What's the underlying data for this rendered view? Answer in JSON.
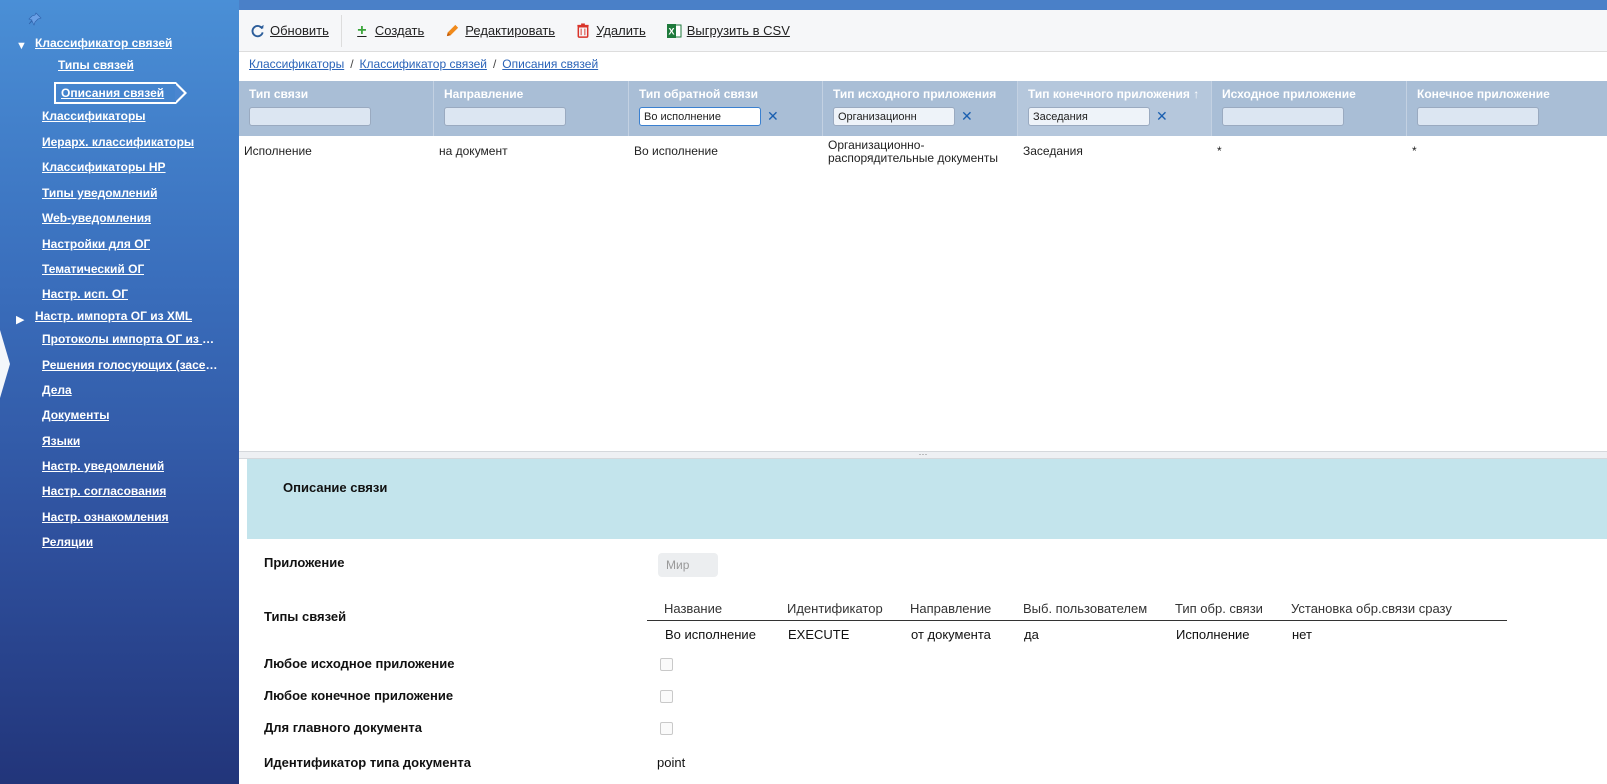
{
  "sidebar": {
    "items": [
      {
        "label": "Классификатор связей",
        "expanded": true,
        "level": 0
      },
      {
        "label": "Типы связей",
        "level": 2
      },
      {
        "label": "Описания связей",
        "level": 2,
        "active": true
      },
      {
        "label": "Классификаторы",
        "level": 1
      },
      {
        "label": "Иерарх. классификаторы",
        "level": 1
      },
      {
        "label": "Классификаторы НР",
        "level": 1
      },
      {
        "label": "Типы уведомлений",
        "level": 1
      },
      {
        "label": "Web-уведомления",
        "level": 1
      },
      {
        "label": "Настройки для ОГ",
        "level": 1
      },
      {
        "label": "Тематический ОГ",
        "level": 1
      },
      {
        "label": "Настр. исп. ОГ",
        "level": 1
      },
      {
        "label": "Настр. импорта ОГ из XML",
        "expanded": false,
        "level": 0
      },
      {
        "label": "Протоколы импорта ОГ из XML",
        "level": 1
      },
      {
        "label": "Решения голосующих (заседаний)",
        "level": 1
      },
      {
        "label": "Дела",
        "level": 1
      },
      {
        "label": "Документы",
        "level": 1
      },
      {
        "label": "Языки",
        "level": 1
      },
      {
        "label": "Настр. уведомлений",
        "level": 1
      },
      {
        "label": "Настр. согласования",
        "level": 1
      },
      {
        "label": "Настр. ознакомления",
        "level": 1
      },
      {
        "label": "Реляции",
        "level": 1
      }
    ]
  },
  "toolbar": {
    "refresh": "Обновить",
    "create": "Создать",
    "edit": "Редактировать",
    "delete": "Удалить",
    "export": "Выгрузить в CSV"
  },
  "breadcrumb": [
    "Классификаторы",
    "Классификатор связей",
    "Описания связей"
  ],
  "grid": {
    "columns": [
      {
        "title": "Тип связи",
        "filter": ""
      },
      {
        "title": "Направление",
        "filter": ""
      },
      {
        "title": "Тип обратной связи",
        "filter": "Во исполнение"
      },
      {
        "title": "Тип исходного приложения",
        "filter": "Организационн"
      },
      {
        "title": "Тип конечного приложения ↑",
        "filter": "Заседания"
      },
      {
        "title": "Исходное приложение",
        "filter": ""
      },
      {
        "title": "Конечное приложение",
        "filter": ""
      }
    ],
    "rows": [
      [
        "Исполнение",
        "на документ",
        "Во исполнение",
        "Организационно-распорядительные документы",
        "Заседания",
        "*",
        "*"
      ]
    ]
  },
  "detail": {
    "title": "Описание связи",
    "app_label": "Приложение",
    "app_placeholder": "Мир",
    "link_types_label": "Типы связей",
    "link_types_table": {
      "headers": [
        "Название",
        "Идентификатор",
        "Направление",
        "Выб. пользователем",
        "Тип обр. связи",
        "Установка обр.связи сразу"
      ],
      "rows": [
        [
          "Во исполнение",
          "EXECUTE",
          "от документа",
          "да",
          "Исполнение",
          "нет"
        ]
      ]
    },
    "any_source_label": "Любое исходное приложение",
    "any_target_label": "Любое конечное приложение",
    "main_doc_label": "Для главного документа",
    "doc_type_id_label": "Идентификатор типа документа",
    "doc_type_id_value": "point"
  }
}
